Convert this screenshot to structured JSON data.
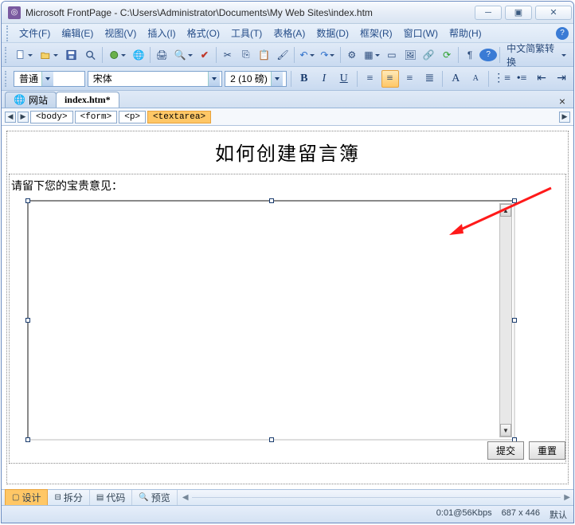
{
  "titlebar": {
    "title": "Microsoft FrontPage - C:\\Users\\Administrator\\Documents\\My Web Sites\\index.htm"
  },
  "menus": [
    "文件(F)",
    "编辑(E)",
    "视图(V)",
    "插入(I)",
    "格式(O)",
    "工具(T)",
    "表格(A)",
    "数据(D)",
    "框架(R)",
    "窗口(W)",
    "帮助(H)"
  ],
  "toolbar": {
    "cnconvert": "中文简繁转换"
  },
  "format": {
    "style": "普通",
    "font": "宋体",
    "size": "2 (10 磅)"
  },
  "doctabs": {
    "site": "网站",
    "file": "index.htm*"
  },
  "tagpath": [
    "<body>",
    "<form>",
    "<p>",
    "<textarea>"
  ],
  "page": {
    "heading": "如何创建留言簿",
    "prompt": "请留下您的宝贵意见：",
    "submit": "提交",
    "reset": "重置"
  },
  "viewtabs": {
    "design": "设计",
    "split": "拆分",
    "code": "代码",
    "preview": "预览"
  },
  "status": {
    "speed": "0:01@56Kbps",
    "dims": "687 x 446",
    "mode": "默认"
  }
}
